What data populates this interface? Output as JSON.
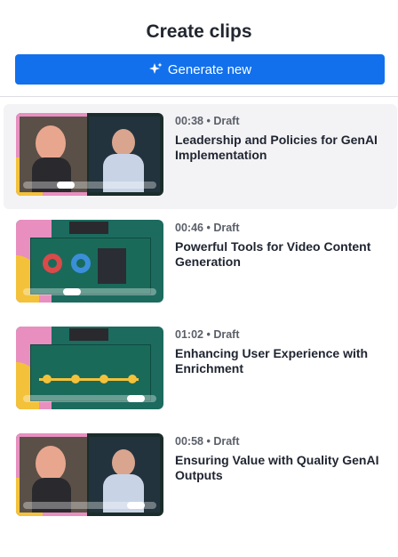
{
  "header": {
    "title": "Create clips"
  },
  "generate_button": {
    "label": "Generate new",
    "icon": "sparkles-icon"
  },
  "colors": {
    "accent": "#1270ec",
    "selected_bg": "#f3f3f5"
  },
  "clips": [
    {
      "duration": "00:38",
      "status": "Draft",
      "title": "Leadership and Policies for GenAI Implementation",
      "progress": 0.25,
      "thumb_type": "speakers"
    },
    {
      "duration": "00:46",
      "status": "Draft",
      "title": "Powerful Tools for Video Content Generation",
      "progress": 0.3,
      "thumb_type": "slide-charts"
    },
    {
      "duration": "01:02",
      "status": "Draft",
      "title": "Enhancing User Experience with Enrichment",
      "progress": 0.78,
      "thumb_type": "slide-timeline"
    },
    {
      "duration": "00:58",
      "status": "Draft",
      "title": "Ensuring Value with Quality GenAI Outputs",
      "progress": 0.78,
      "thumb_type": "speakers"
    }
  ]
}
